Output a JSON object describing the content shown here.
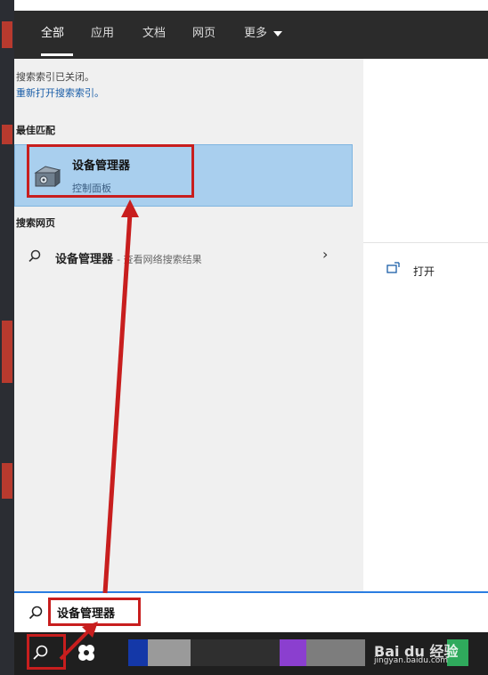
{
  "tabs": [
    {
      "label": "全部",
      "active": true
    },
    {
      "label": "应用",
      "active": false
    },
    {
      "label": "文档",
      "active": false
    },
    {
      "label": "网页",
      "active": false
    },
    {
      "label": "更多",
      "active": false
    }
  ],
  "index_notice": {
    "message": "搜索索引已关闭。",
    "link": "重新打开搜索索引。"
  },
  "best_match": {
    "section_title": "最佳匹配",
    "title": "设备管理器",
    "subtitle": "控制面板",
    "icon": "device-manager-icon"
  },
  "web_search": {
    "section_title": "搜索网页",
    "query": "设备管理器",
    "suffix": "- 查看网络搜索结果",
    "icon": "search-icon"
  },
  "right_panel": {
    "actions": [
      {
        "label": "打开",
        "icon": "open-window-icon"
      }
    ]
  },
  "search_bar": {
    "value": "设备管理器",
    "icon": "search-icon"
  },
  "taskbar": {
    "search_icon": "search-icon",
    "app_icon": "pinwheel-app-icon"
  },
  "watermark": {
    "brand": "Bai du 经验",
    "url": "jingyan.baidu.com"
  },
  "colors": {
    "header_bg": "#2b2b2b",
    "selected_item": "#a9cfee",
    "annotation_red": "#c81e1e",
    "search_border": "#2a7de1"
  }
}
